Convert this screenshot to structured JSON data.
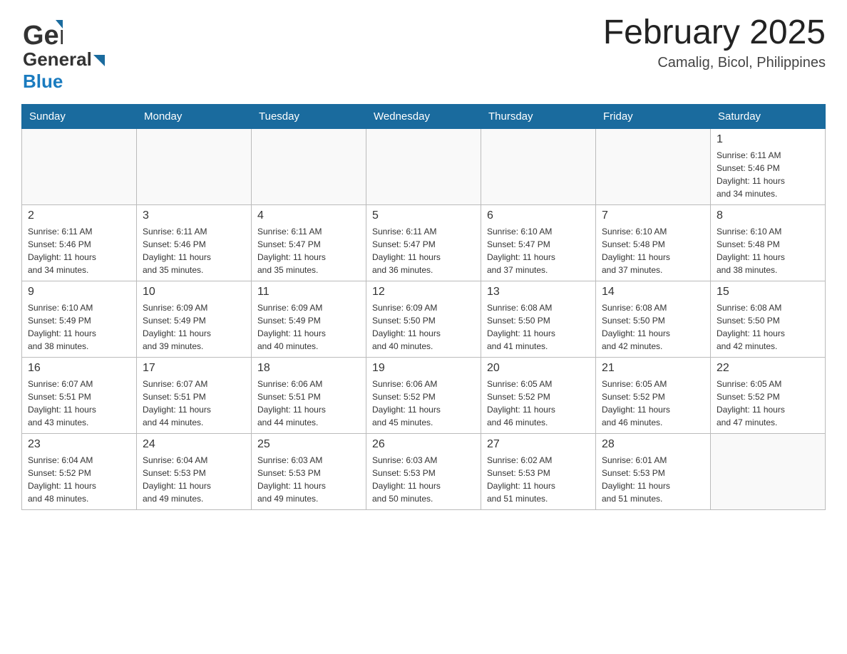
{
  "header": {
    "logo": {
      "text_general": "General",
      "text_blue": "Blue",
      "alt": "GeneralBlue logo"
    },
    "title": "February 2025",
    "subtitle": "Camalig, Bicol, Philippines"
  },
  "calendar": {
    "days_of_week": [
      "Sunday",
      "Monday",
      "Tuesday",
      "Wednesday",
      "Thursday",
      "Friday",
      "Saturday"
    ],
    "weeks": [
      [
        {
          "day": "",
          "info": ""
        },
        {
          "day": "",
          "info": ""
        },
        {
          "day": "",
          "info": ""
        },
        {
          "day": "",
          "info": ""
        },
        {
          "day": "",
          "info": ""
        },
        {
          "day": "",
          "info": ""
        },
        {
          "day": "1",
          "info": "Sunrise: 6:11 AM\nSunset: 5:46 PM\nDaylight: 11 hours\nand 34 minutes."
        }
      ],
      [
        {
          "day": "2",
          "info": "Sunrise: 6:11 AM\nSunset: 5:46 PM\nDaylight: 11 hours\nand 34 minutes."
        },
        {
          "day": "3",
          "info": "Sunrise: 6:11 AM\nSunset: 5:46 PM\nDaylight: 11 hours\nand 35 minutes."
        },
        {
          "day": "4",
          "info": "Sunrise: 6:11 AM\nSunset: 5:47 PM\nDaylight: 11 hours\nand 35 minutes."
        },
        {
          "day": "5",
          "info": "Sunrise: 6:11 AM\nSunset: 5:47 PM\nDaylight: 11 hours\nand 36 minutes."
        },
        {
          "day": "6",
          "info": "Sunrise: 6:10 AM\nSunset: 5:47 PM\nDaylight: 11 hours\nand 37 minutes."
        },
        {
          "day": "7",
          "info": "Sunrise: 6:10 AM\nSunset: 5:48 PM\nDaylight: 11 hours\nand 37 minutes."
        },
        {
          "day": "8",
          "info": "Sunrise: 6:10 AM\nSunset: 5:48 PM\nDaylight: 11 hours\nand 38 minutes."
        }
      ],
      [
        {
          "day": "9",
          "info": "Sunrise: 6:10 AM\nSunset: 5:49 PM\nDaylight: 11 hours\nand 38 minutes."
        },
        {
          "day": "10",
          "info": "Sunrise: 6:09 AM\nSunset: 5:49 PM\nDaylight: 11 hours\nand 39 minutes."
        },
        {
          "day": "11",
          "info": "Sunrise: 6:09 AM\nSunset: 5:49 PM\nDaylight: 11 hours\nand 40 minutes."
        },
        {
          "day": "12",
          "info": "Sunrise: 6:09 AM\nSunset: 5:50 PM\nDaylight: 11 hours\nand 40 minutes."
        },
        {
          "day": "13",
          "info": "Sunrise: 6:08 AM\nSunset: 5:50 PM\nDaylight: 11 hours\nand 41 minutes."
        },
        {
          "day": "14",
          "info": "Sunrise: 6:08 AM\nSunset: 5:50 PM\nDaylight: 11 hours\nand 42 minutes."
        },
        {
          "day": "15",
          "info": "Sunrise: 6:08 AM\nSunset: 5:50 PM\nDaylight: 11 hours\nand 42 minutes."
        }
      ],
      [
        {
          "day": "16",
          "info": "Sunrise: 6:07 AM\nSunset: 5:51 PM\nDaylight: 11 hours\nand 43 minutes."
        },
        {
          "day": "17",
          "info": "Sunrise: 6:07 AM\nSunset: 5:51 PM\nDaylight: 11 hours\nand 44 minutes."
        },
        {
          "day": "18",
          "info": "Sunrise: 6:06 AM\nSunset: 5:51 PM\nDaylight: 11 hours\nand 44 minutes."
        },
        {
          "day": "19",
          "info": "Sunrise: 6:06 AM\nSunset: 5:52 PM\nDaylight: 11 hours\nand 45 minutes."
        },
        {
          "day": "20",
          "info": "Sunrise: 6:05 AM\nSunset: 5:52 PM\nDaylight: 11 hours\nand 46 minutes."
        },
        {
          "day": "21",
          "info": "Sunrise: 6:05 AM\nSunset: 5:52 PM\nDaylight: 11 hours\nand 46 minutes."
        },
        {
          "day": "22",
          "info": "Sunrise: 6:05 AM\nSunset: 5:52 PM\nDaylight: 11 hours\nand 47 minutes."
        }
      ],
      [
        {
          "day": "23",
          "info": "Sunrise: 6:04 AM\nSunset: 5:52 PM\nDaylight: 11 hours\nand 48 minutes."
        },
        {
          "day": "24",
          "info": "Sunrise: 6:04 AM\nSunset: 5:53 PM\nDaylight: 11 hours\nand 49 minutes."
        },
        {
          "day": "25",
          "info": "Sunrise: 6:03 AM\nSunset: 5:53 PM\nDaylight: 11 hours\nand 49 minutes."
        },
        {
          "day": "26",
          "info": "Sunrise: 6:03 AM\nSunset: 5:53 PM\nDaylight: 11 hours\nand 50 minutes."
        },
        {
          "day": "27",
          "info": "Sunrise: 6:02 AM\nSunset: 5:53 PM\nDaylight: 11 hours\nand 51 minutes."
        },
        {
          "day": "28",
          "info": "Sunrise: 6:01 AM\nSunset: 5:53 PM\nDaylight: 11 hours\nand 51 minutes."
        },
        {
          "day": "",
          "info": ""
        }
      ]
    ]
  }
}
